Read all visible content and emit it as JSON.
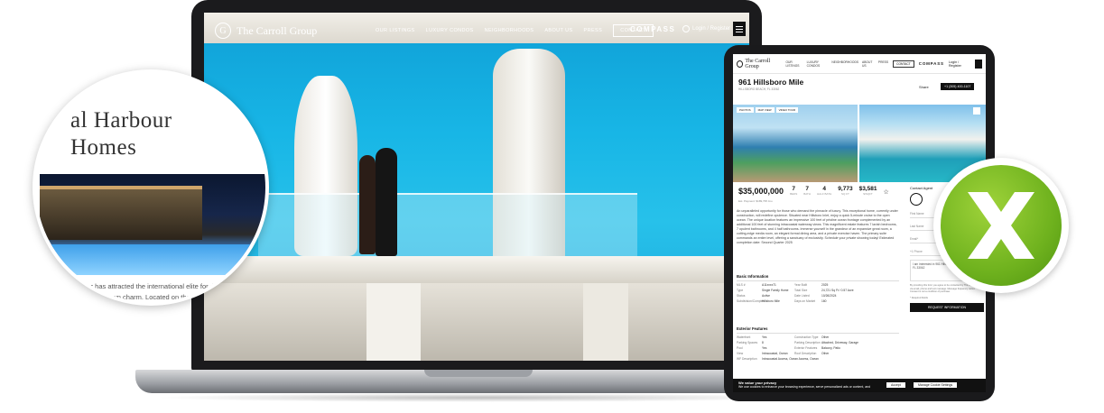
{
  "laptop_site": {
    "brand": "The Carroll Group",
    "nav": [
      "OUR LISTINGS",
      "LUXURY CONDOS",
      "NEIGHBORHOODS",
      "ABOUT US",
      "PRESS"
    ],
    "contact": "CONTACT",
    "partner": "COMPASS",
    "login": "Login / Register"
  },
  "circle_page": {
    "title_line1": "al Harbour",
    "title_line2": "Homes",
    "paragraph": "Harbour has attracted the international elite for decades, yet it has never lost its own charm. Located on the northernmost tip of the man made island, Bal Harbour is close enough to South Beach for all of the action, yet offers an experience total relaxation. Balmy days, summer nights... a few of its many virtues. In"
  },
  "tablet_site": {
    "brand": "The Carroll Group",
    "nav": [
      "OUR LISTINGS",
      "LUXURY CONDOS",
      "NEIGHBORHOODS",
      "ABOUT US",
      "PRESS"
    ],
    "contact": "CONTACT",
    "partner": "COMPASS",
    "login": "Login / Register",
    "listing": {
      "address": "961 Hillsboro Mile",
      "location": "HILLSBORO BEACH, FL 33062",
      "share": "Share",
      "call": "+1 (305) 400-1107",
      "photo_tabs": [
        "PHOTOS",
        "MAP VIEW",
        "VIDEO TOUR"
      ],
      "price": "$35,000,000",
      "payment": "Est. Payment: $189,795 /mo",
      "stats": [
        {
          "value": "7",
          "label": "BEDS"
        },
        {
          "value": "7",
          "label": "BATH"
        },
        {
          "value": "4",
          "label": "HALF BATH"
        },
        {
          "value": "9,773",
          "label": "SQ FT"
        },
        {
          "value": "$3,581",
          "label": "$/SQFT"
        }
      ],
      "description": "An unparalleled opportunity for those who demand the pinnacle of luxury. This exceptional home, currently under construction, will redefine opulence. Situated near Hillsboro Inlet, enjoy a quick 5-minute cruise to the open ocean. The unique location features an impressive 100 feet of pristine ocean frontage complemented by an additional 100 feet of stunning intracoastal waterway views. This magnificent estate features 7 lavish bedrooms, 7 opulent bathrooms, and 4 half bathrooms. Immerse yourself in the grandeur of an expansive great room, a cutting-edge media room, an elegant formal dining area, and a private exercise haven. The primary suite commands an entire level, offering a sanctuary of exclusivity. Schedule your private showing today! Estimated completion date: Second Quarter 2025",
      "basic_title": "Basic Information",
      "basic": [
        [
          "MLS #",
          "A11xxxx71",
          "Year Built",
          "2025"
        ],
        [
          "Type",
          "Single Family Home",
          "Total Size",
          "24,721 Sq Ft / 0.57 Acre"
        ],
        [
          "Status",
          "Active",
          "Date Listed",
          "10/26/2024"
        ],
        [
          "Subdivision/Complex",
          "Hillsboro Mile",
          "Days on Market",
          "160"
        ]
      ],
      "exterior_title": "Exterior Features",
      "exterior": [
        [
          "Waterfront",
          "Yes",
          "Construction Type",
          "Other"
        ],
        [
          "Parking Spaces",
          "8",
          "Parking Description",
          "Attached, Driveway, Garage"
        ],
        [
          "Pool",
          "Yes",
          "Exterior Features",
          "Balcony, Patio"
        ],
        [
          "View",
          "Intracoastal, Ocean",
          "Roof Description",
          "Other"
        ],
        [
          "WF Description",
          "Intracoastal Access, Ocean Access, Ocean",
          "",
          ""
        ]
      ]
    },
    "agent": {
      "title": "Contact Agent",
      "first_name": "First Name",
      "last_name": "Last Name",
      "email": "Email*",
      "phone": "Phone",
      "country": "+1",
      "message": "I am interested in 961 Hillsboro Mile, Hillsboro Beach, FL 33062",
      "consent": "By providing this form you agree to be contacted by The Carroll Group via email, phone and text message. Message frequency varies. Consent is not a condition of purchase.",
      "required_note": "* Required Fields",
      "button": "REQUEST INFORMATION"
    },
    "cookie": {
      "title": "We value your privacy",
      "text": "We use cookies to enhance your browsing experience, serve personalized ads or content, and",
      "accept": "Accept",
      "manage": "Manage Cookie Settings"
    }
  },
  "colors": {
    "badge_green": "#6fb21e",
    "sky_blue": "#18b6e6",
    "dark": "#111111"
  }
}
